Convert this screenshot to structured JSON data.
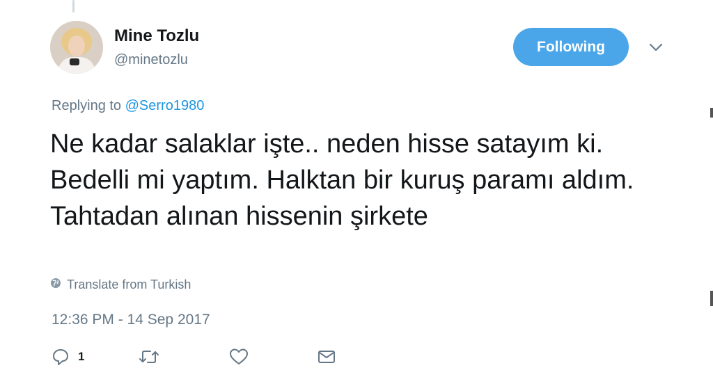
{
  "author": {
    "name": "Mine Tozlu",
    "handle": "@minetozlu"
  },
  "follow_button": {
    "label": "Following"
  },
  "reply_context": {
    "prefix": "Replying to ",
    "mention": "@Serro1980"
  },
  "tweet": {
    "text": "Ne kadar salaklar işte.. neden hisse satayım ki. Bedelli mi yaptım. Halktan bir kuruş paramı aldım. Tahtadan alınan hissenin şirkete",
    "translate_label": "Translate from Turkish",
    "timestamp": "12:36 PM - 14 Sep 2017"
  },
  "actions": {
    "reply_count": "1",
    "icons": [
      "reply-icon",
      "retweet-icon",
      "like-icon",
      "message-icon"
    ]
  },
  "colors": {
    "accent": "#4aa6e8",
    "link": "#1b95e0",
    "muted": "#657786",
    "text": "#14171a"
  }
}
